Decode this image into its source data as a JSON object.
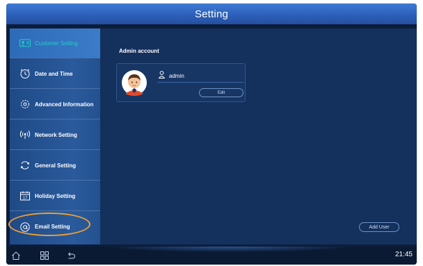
{
  "window": {
    "title": "Setting"
  },
  "sidebar": {
    "items": [
      {
        "label": "Customer Setting",
        "icon": "user-card-icon",
        "active": true
      },
      {
        "label": "Date and Time",
        "icon": "clock-icon",
        "active": false
      },
      {
        "label": "Advanced Information",
        "icon": "gear-icon",
        "active": false
      },
      {
        "label": "Network Setting",
        "icon": "wifi-icon",
        "active": false
      },
      {
        "label": "General Setting",
        "icon": "sync-icon",
        "active": false
      },
      {
        "label": "Holiday Setting",
        "icon": "calendar-icon",
        "active": false
      },
      {
        "label": "Email Setting",
        "icon": "at-sign-icon",
        "active": false
      }
    ]
  },
  "main": {
    "section_title": "Admin account",
    "account": {
      "username": "admin",
      "edit_label": "Edit",
      "avatar_icon": "avatar-icon",
      "user_icon": "user-icon"
    },
    "add_user_label": "Add User"
  },
  "taskbar": {
    "icons": [
      "home-icon",
      "apps-icon",
      "back-icon"
    ],
    "time": "21:45"
  },
  "colors": {
    "title_bar": "#2b5eb8",
    "sidebar": "#24518f",
    "main_panel": "#14305d",
    "active_label": "#1fd2c4",
    "highlight": "#f0a030"
  }
}
